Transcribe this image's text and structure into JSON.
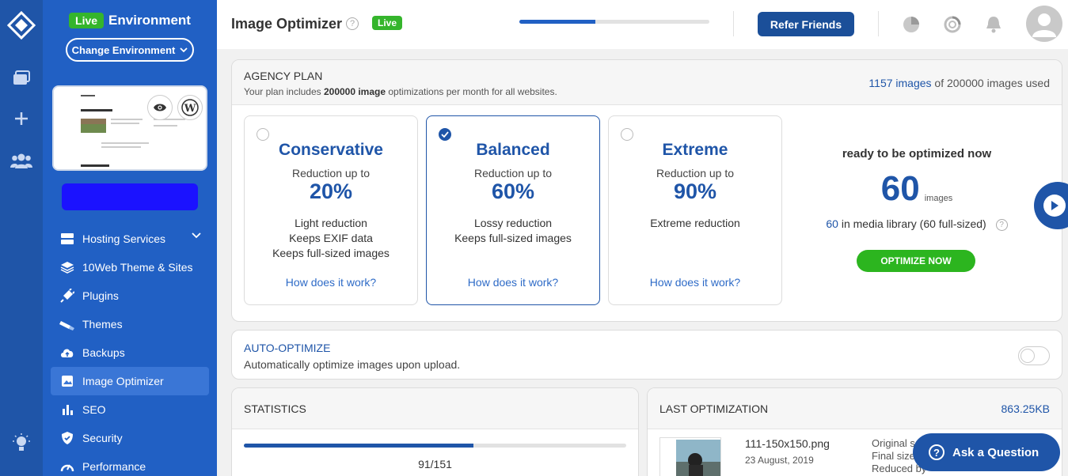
{
  "env": {
    "live_label": "Live",
    "title": "Environment",
    "change_label": "Change Environment"
  },
  "nav": [
    {
      "label": "Hosting Services",
      "icon": "server-stack-icon"
    },
    {
      "label": "10Web Theme & Sites",
      "icon": "layers-icon"
    },
    {
      "label": "Plugins",
      "icon": "plug-icon"
    },
    {
      "label": "Themes",
      "icon": "brush-icon"
    },
    {
      "label": "Backups",
      "icon": "cloud-upload-icon"
    },
    {
      "label": "Image Optimizer",
      "icon": "image-icon"
    },
    {
      "label": "SEO",
      "icon": "bar-chart-icon"
    },
    {
      "label": "Security",
      "icon": "shield-check-icon"
    },
    {
      "label": "Performance",
      "icon": "speedometer-icon"
    }
  ],
  "topbar": {
    "title": "Image Optimizer",
    "live_label": "Live",
    "refer_label": "Refer Friends",
    "progress": 0.4
  },
  "plan": {
    "title": "AGENCY PLAN",
    "subtitle_pre": "Your plan includes ",
    "subtitle_bold": "200000 image",
    "subtitle_post": " optimizations per month for all websites.",
    "used_count": "1157 images",
    "used_rest": " of 200000 images used",
    "options": [
      {
        "name": "Conservative",
        "reduction": "Reduction up to",
        "pct": "20%",
        "features": [
          "Light reduction",
          "Keeps EXIF data",
          "Keeps full-sized images"
        ],
        "how": "How does it work?",
        "selected": false
      },
      {
        "name": "Balanced",
        "reduction": "Reduction up to",
        "pct": "60%",
        "features": [
          "Lossy reduction",
          "Keeps full-sized images"
        ],
        "how": "How does it work?",
        "selected": true
      },
      {
        "name": "Extreme",
        "reduction": "Reduction up to",
        "pct": "90%",
        "features": [
          "Extreme reduction"
        ],
        "how": "How does it work?",
        "selected": false
      }
    ],
    "ready_label": "ready to be optimized now",
    "ready_count": "60",
    "ready_unit": "images",
    "library_count": "60",
    "library_text": " in media library (60 full-sized)",
    "optimize_label": "OPTIMIZE NOW"
  },
  "auto": {
    "title": "AUTO-OPTIMIZE",
    "desc": "Automatically optimize images upon upload.",
    "enabled": false
  },
  "stats": {
    "title": "STATISTICS",
    "count": "91/151",
    "progress": 0.6
  },
  "last": {
    "title": "LAST OPTIMIZATION",
    "size": "863.25KB",
    "file": "111-150x150.png",
    "date": "23 August, 2019",
    "original_label": "Original s",
    "final_label": "Final size",
    "reduced_label": "Reduced by"
  },
  "ask_label": "Ask a Question",
  "colors": {
    "primary": "#1f55a8",
    "sidebar": "#2160c4",
    "green": "#35b52c"
  }
}
